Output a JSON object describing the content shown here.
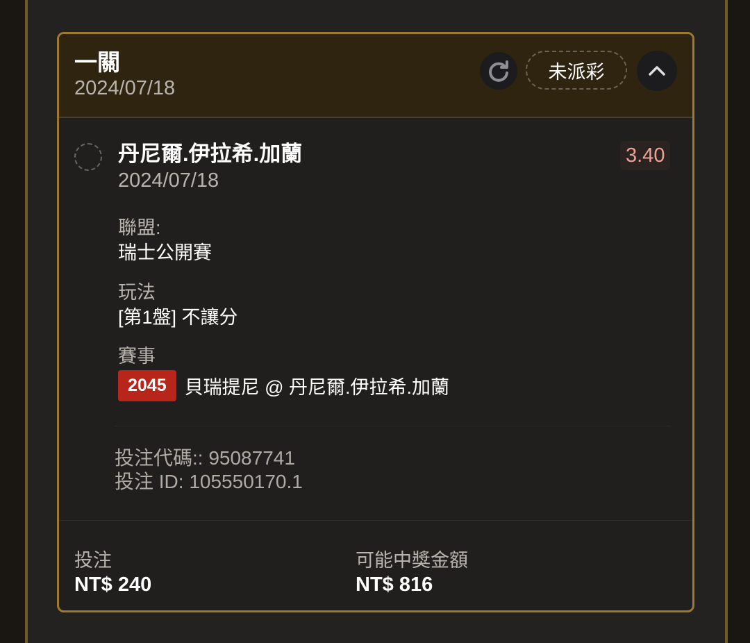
{
  "card": {
    "title": "一關",
    "date": "2024/07/18",
    "status": "未派彩",
    "icons": {
      "refresh": "refresh-icon",
      "collapse": "chevron-up-icon"
    }
  },
  "selection": {
    "name": "丹尼爾.伊拉希.加蘭",
    "date": "2024/07/18",
    "odds": "3.40",
    "league_label": "聯盟:",
    "league_value": "瑞士公開賽",
    "market_label": "玩法",
    "market_value": "[第1盤] 不讓分",
    "event_label": "賽事",
    "event_id": "2045",
    "event_name": "貝瑞提尼 @ 丹尼爾.伊拉希.加蘭"
  },
  "bet_info": {
    "code": "投注代碼:: 95087741",
    "id": "投注 ID: 105550170.1"
  },
  "footer": {
    "stake_label": "投注",
    "stake_value": "NT$ 240",
    "payout_label": "可能中獎金額",
    "payout_value": "NT$ 816"
  },
  "colors": {
    "card_border": "#9d7a2e",
    "header_bg": "#2e2410",
    "odds_text": "#f0a09a",
    "event_badge": "#b8261b"
  }
}
